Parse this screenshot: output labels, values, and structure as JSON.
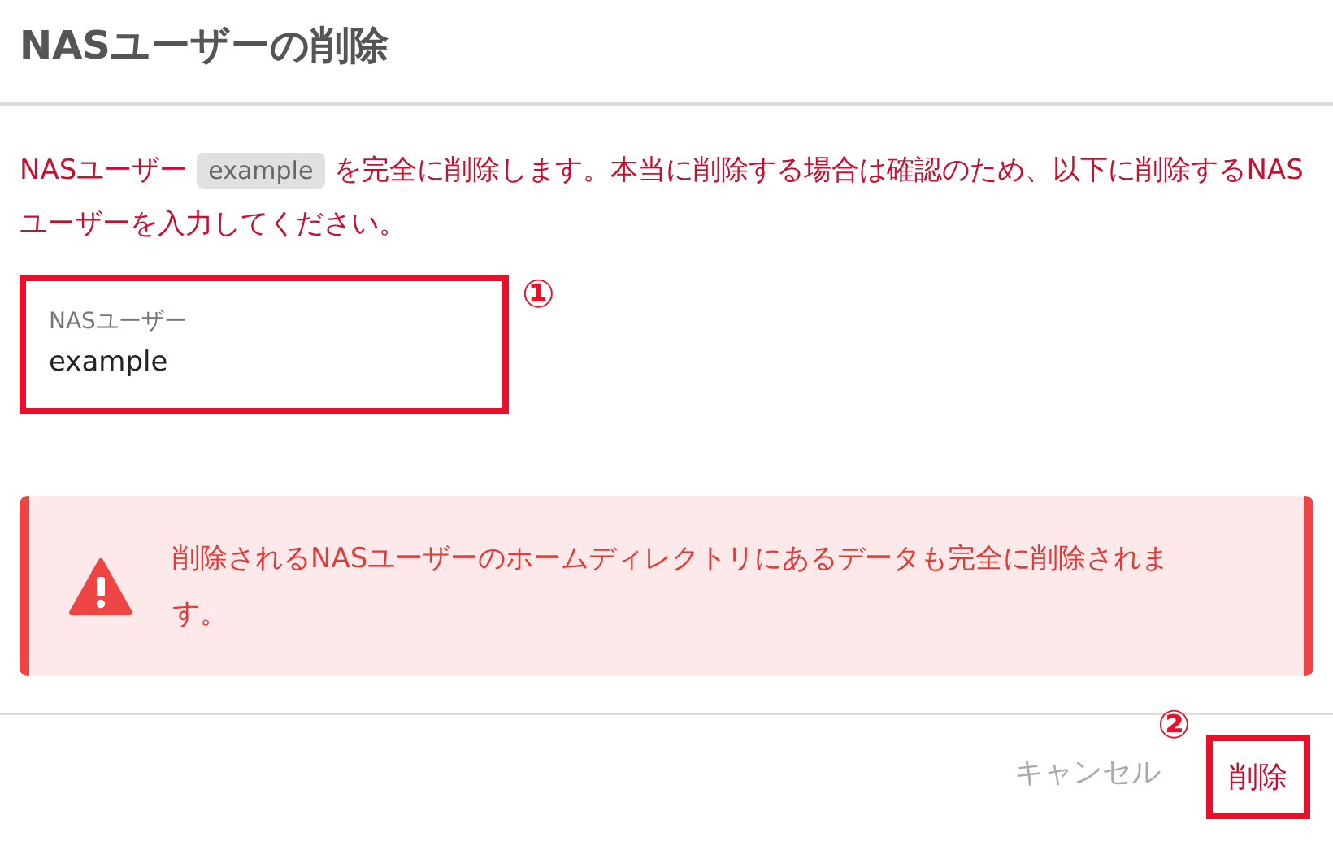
{
  "dialog": {
    "title": "NASユーザーの削除"
  },
  "message": {
    "before": "NASユーザー",
    "chip": "example",
    "after": "を完全に削除します。本当に削除する場合は確認のため、以下に削除するNASユーザーを入力してください。"
  },
  "field": {
    "label": "NASユーザー",
    "value": "example",
    "highlighted": true,
    "marker": "①"
  },
  "alert": {
    "text": "削除されるNASユーザーのホームディレクトリにあるデータも完全に削除されます。"
  },
  "buttons": [
    {
      "label": "キャンセル",
      "kind": "text",
      "highlighted": false
    },
    {
      "label": "削除",
      "kind": "danger",
      "highlighted": true,
      "marker": "②"
    }
  ]
}
